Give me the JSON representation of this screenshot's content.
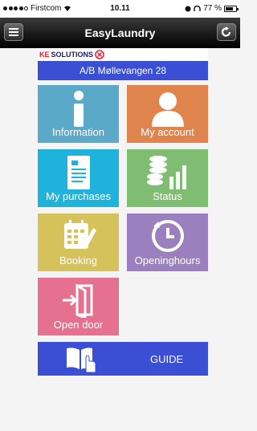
{
  "status_bar": {
    "carrier": "Firstcom",
    "time": "10.11",
    "battery": "77 %",
    "battery_level": 0.77
  },
  "nav": {
    "title": "EasyLaundry",
    "menu_icon": "menu-list-icon",
    "refresh_icon": "refresh-icon"
  },
  "banner": {
    "logo_ke": "KE",
    "logo_solutions": "SOLUTIONS",
    "address": "A/B Møllevangen 28"
  },
  "tiles": [
    {
      "label": "Information",
      "color": "#5aa9c8",
      "icon": "info-icon"
    },
    {
      "label": "My account",
      "color": "#e0844d",
      "icon": "person-icon"
    },
    {
      "label": "My purchases",
      "color": "#1fb3dc",
      "icon": "receipt-icon"
    },
    {
      "label": "Status",
      "color": "#7fbd72",
      "icon": "coins-chart-icon"
    },
    {
      "label": "Booking",
      "color": "#d6c25a",
      "icon": "calendar-icon"
    },
    {
      "label": "Openinghours",
      "color": "#9b7fbf",
      "icon": "clock-icon"
    },
    {
      "label": "Open door",
      "color": "#e6708f",
      "icon": "door-icon"
    }
  ],
  "guide": {
    "label": "GUIDE",
    "color": "#3a4fd4",
    "icon": "book-hand-icon"
  }
}
